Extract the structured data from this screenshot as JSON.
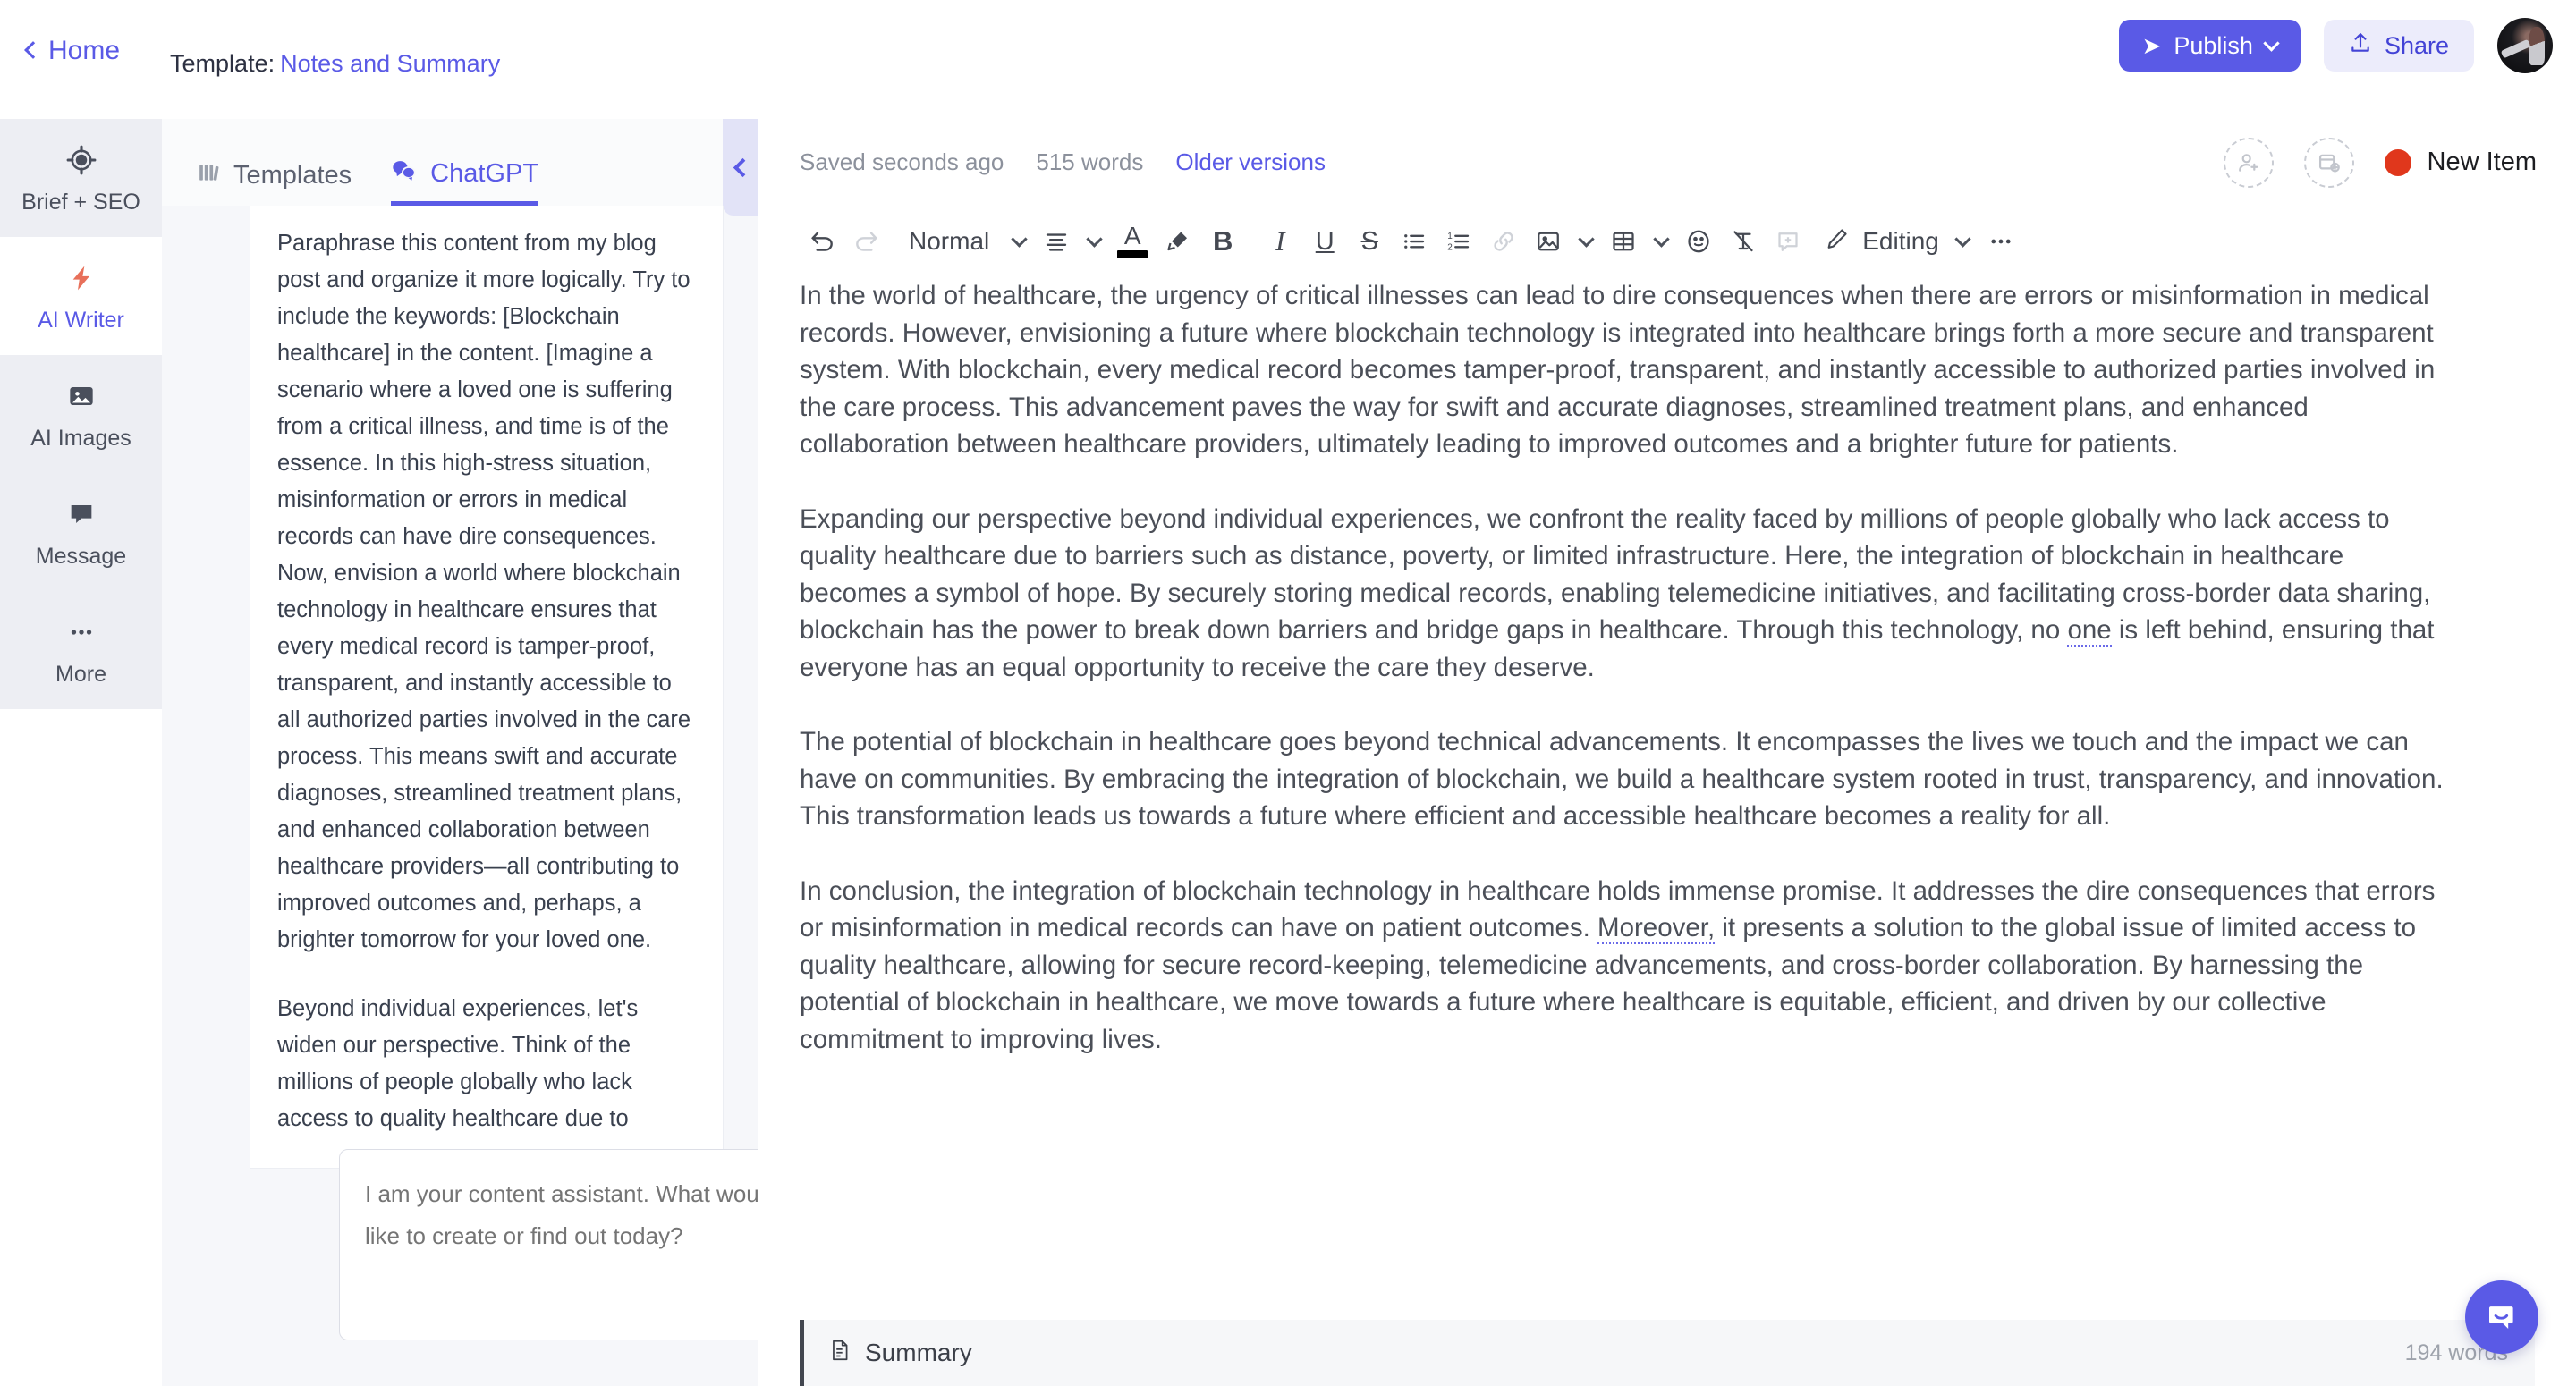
{
  "topbar": {
    "home_label": "Home",
    "template_prefix": "Template:",
    "template_name": "Notes and Summary",
    "publish_label": "Publish",
    "share_label": "Share"
  },
  "rail": {
    "items": [
      {
        "label": "Brief + SEO",
        "icon": "target-icon"
      },
      {
        "label": "AI Writer",
        "icon": "lightning-icon"
      },
      {
        "label": "AI Images",
        "icon": "image-icon"
      },
      {
        "label": "Message",
        "icon": "message-icon"
      },
      {
        "label": "More",
        "icon": "ellipsis-icon"
      }
    ]
  },
  "chat": {
    "tabs": [
      {
        "label": "Templates",
        "icon": "templates-icon",
        "active": false
      },
      {
        "label": "ChatGPT",
        "icon": "chat-bubbles-icon",
        "active": true
      }
    ],
    "messages": [
      "Paraphrase this content from my blog post and organize it more logically. Try to include the keywords: [Blockchain healthcare] in the content. [Imagine a scenario where a loved one is suffering from a critical illness, and time is of the essence. In this high-stress situation, misinformation or errors in medical records can have dire consequences. Now, envision a world where blockchain technology in healthcare ensures that every medical record is tamper-proof, transparent, and instantly accessible to all authorized parties involved in the care process. This means swift and accurate diagnoses, streamlined treatment plans, and enhanced collaboration between healthcare providers—all contributing to improved outcomes and, perhaps, a brighter tomorrow for your loved one.",
      "Beyond individual experiences, let's widen our perspective. Think of the millions of people globally who lack access to quality healthcare due to"
    ],
    "input_placeholder": "I am your content assistant. What would you like to create or find out today?",
    "input_value": ""
  },
  "editor": {
    "saved_status": "Saved seconds ago",
    "word_count": "515 words",
    "older_versions": "Older versions",
    "new_item_label": "New Item",
    "toolbar": {
      "undo": "undo-icon",
      "redo": "redo-icon",
      "style": "Normal",
      "editing_label": "Editing"
    },
    "paragraphs": [
      "In the world of healthcare, the urgency of critical illnesses can lead to dire consequences when there are errors or misinformation in medical records. However, envisioning a future where blockchain technology is integrated into healthcare brings forth a more secure and transparent system. With blockchain, every medical record becomes tamper-proof, transparent, and instantly accessible to authorized parties involved in the care process. This advancement paves the way for swift and accurate diagnoses, streamlined treatment plans, and enhanced collaboration between healthcare providers, ultimately leading to improved outcomes and a brighter future for patients.",
      "Expanding our perspective beyond individual experiences, we confront the reality faced by millions of people globally who lack access to quality healthcare due to barriers such as distance, poverty, or limited infrastructure. Here, the integration of blockchain in healthcare becomes a symbol of hope. By securely storing medical records, enabling telemedicine initiatives, and facilitating cross-border data sharing, blockchain has the power to break down barriers and bridge gaps in healthcare. Through this technology, no one is left behind, ensuring that everyone has an equal opportunity to receive the care they deserve.",
      "The potential of blockchain in healthcare goes beyond technical advancements. It encompasses the lives we touch and the impact we can have on communities. By embracing the integration of blockchain, we build a healthcare system rooted in trust, transparency, and innovation. This transformation leads us towards a future where efficient and accessible healthcare becomes a reality for all.",
      "In conclusion, the integration of blockchain technology in healthcare holds immense promise. It addresses the dire consequences that errors or misinformation in medical records can have on patient outcomes. Moreover, it presents a solution to the global issue of limited access to quality healthcare, allowing for secure record-keeping, telemedicine advancements, and cross-border collaboration. By harnessing the potential of blockchain in healthcare, we move towards a future where healthcare is equitable, efficient, and driven by our collective commitment to improving lives."
    ],
    "summary": {
      "title": "Summary",
      "word_count": "194 words"
    }
  },
  "colors": {
    "accent": "#5a5ae6",
    "status_dot": "#e0371c",
    "share_bg": "#ececfb",
    "panel_bg": "#f6f7fa"
  }
}
